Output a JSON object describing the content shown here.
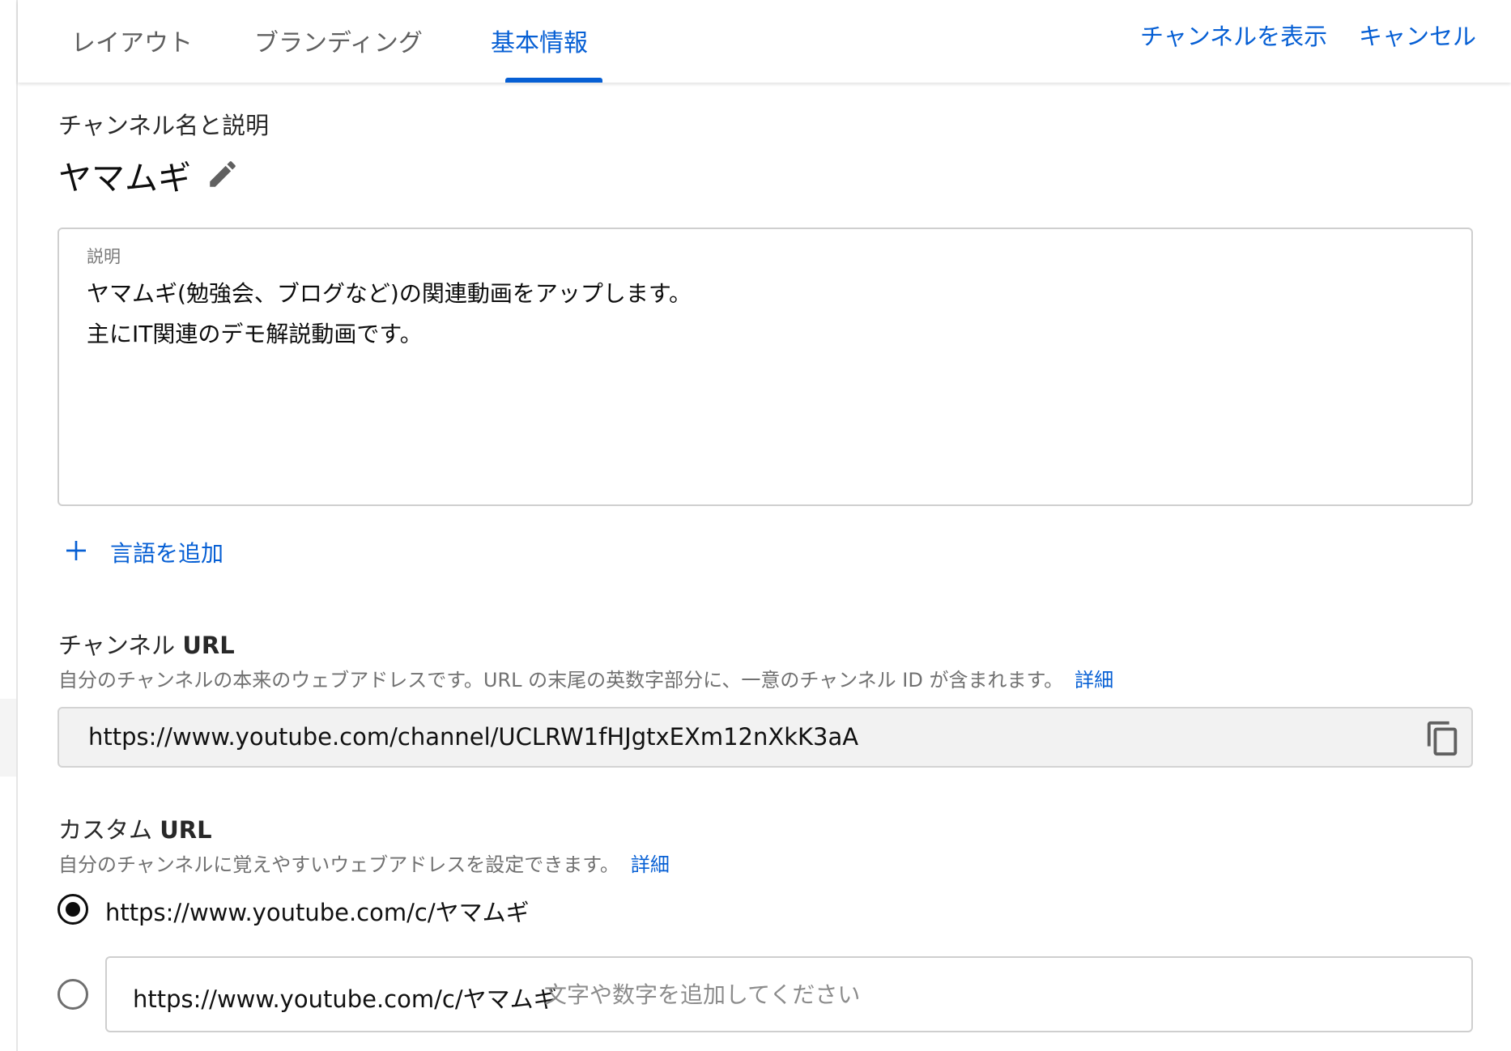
{
  "tabs": [
    {
      "label": "レイアウト",
      "active": false
    },
    {
      "label": "ブランディング",
      "active": false
    },
    {
      "label": "基本情報",
      "active": true
    }
  ],
  "header_actions": {
    "view_channel": "チャンネルを表示",
    "cancel": "キャンセル"
  },
  "name_section": {
    "heading": "チャンネル名と説明",
    "channel_name": "ヤマムギ",
    "edit_icon": "pencil-icon"
  },
  "description": {
    "label": "説明",
    "lines": [
      "ヤマムギ(勉強会、ブログなど)の関連動画をアップします。",
      "主にIT関連のデモ解説動画です。"
    ]
  },
  "add_language": {
    "label": "言語を追加",
    "icon": "plus-icon"
  },
  "channel_url": {
    "title_prefix": "チャンネル ",
    "title_bold": "URL",
    "hint": "自分のチャンネルの本来のウェブアドレスです。URL の末尾の英数字部分に、一意のチャンネル ID が含まれます。",
    "hint_link": "詳細",
    "value": "https://www.youtube.com/channel/UCLRW1fHJgtxEXm12nXkK3aA",
    "copy_icon": "copy-icon"
  },
  "custom_url": {
    "title_prefix": "カスタム ",
    "title_bold": "URL",
    "hint": "自分のチャンネルに覚えやすいウェブアドレスを設定できます。",
    "hint_link": "詳細",
    "option_selected": "https://www.youtube.com/c/ヤマムギ",
    "option_custom_prefix": "https://www.youtube.com/c/ヤマムギ",
    "option_custom_placeholder": "文字や数字を追加してください",
    "option_custom_value": ""
  },
  "colors": {
    "accent": "#065fd4",
    "text": "#0d0d0d",
    "secondary_text": "#717171",
    "border": "#cfcfcf"
  }
}
